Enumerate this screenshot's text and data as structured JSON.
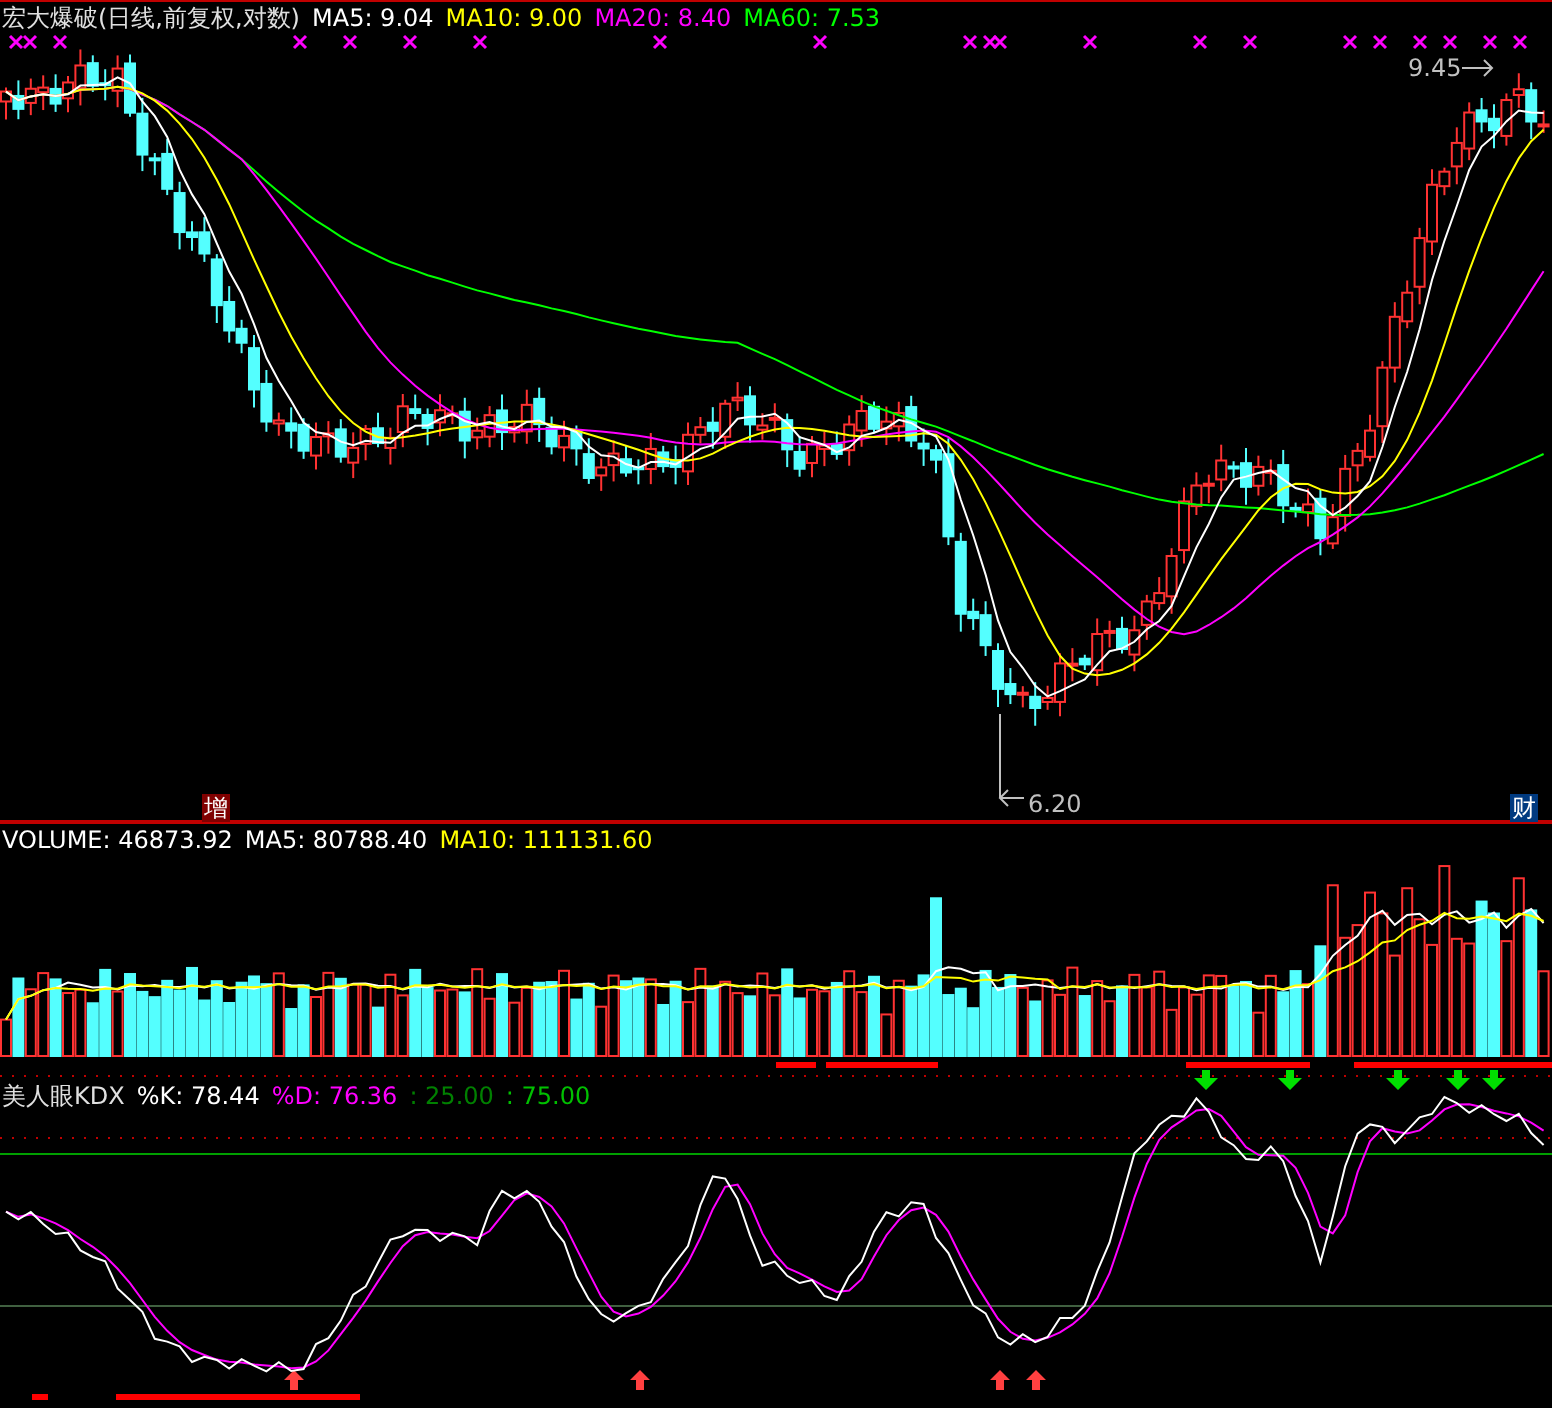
{
  "price_panel": {
    "title": "宏大爆破(日线,前复权,对数)",
    "indicators": [
      {
        "label": "MA5: 9.04",
        "color": "#ffffff"
      },
      {
        "label": "MA10: 9.00",
        "color": "#ffff00"
      },
      {
        "label": "MA20: 8.40",
        "color": "#ff00ff"
      },
      {
        "label": "MA60: 7.53",
        "color": "#00ff00"
      }
    ],
    "high_label": "9.45",
    "low_label": "6.20",
    "badges": [
      {
        "text": "增",
        "color": "#800000"
      },
      {
        "text": "财",
        "color": "#003a80"
      }
    ]
  },
  "volume_panel": {
    "indicators": [
      {
        "label": "VOLUME: 46873.92",
        "color": "#ffffff"
      },
      {
        "label": "MA5: 80788.40",
        "color": "#ffffff"
      },
      {
        "label": "MA10: 111131.60",
        "color": "#ffff00"
      }
    ]
  },
  "kdx_panel": {
    "title": "美人眼KDX",
    "indicators": [
      {
        "label": "%K: 78.44",
        "color": "#ffffff"
      },
      {
        "label": "%D: 76.36",
        "color": "#ff00ff"
      },
      {
        "label": ": 25.00",
        "color": "#008000"
      },
      {
        "label": ": 75.00",
        "color": "#00c000"
      }
    ]
  }
}
